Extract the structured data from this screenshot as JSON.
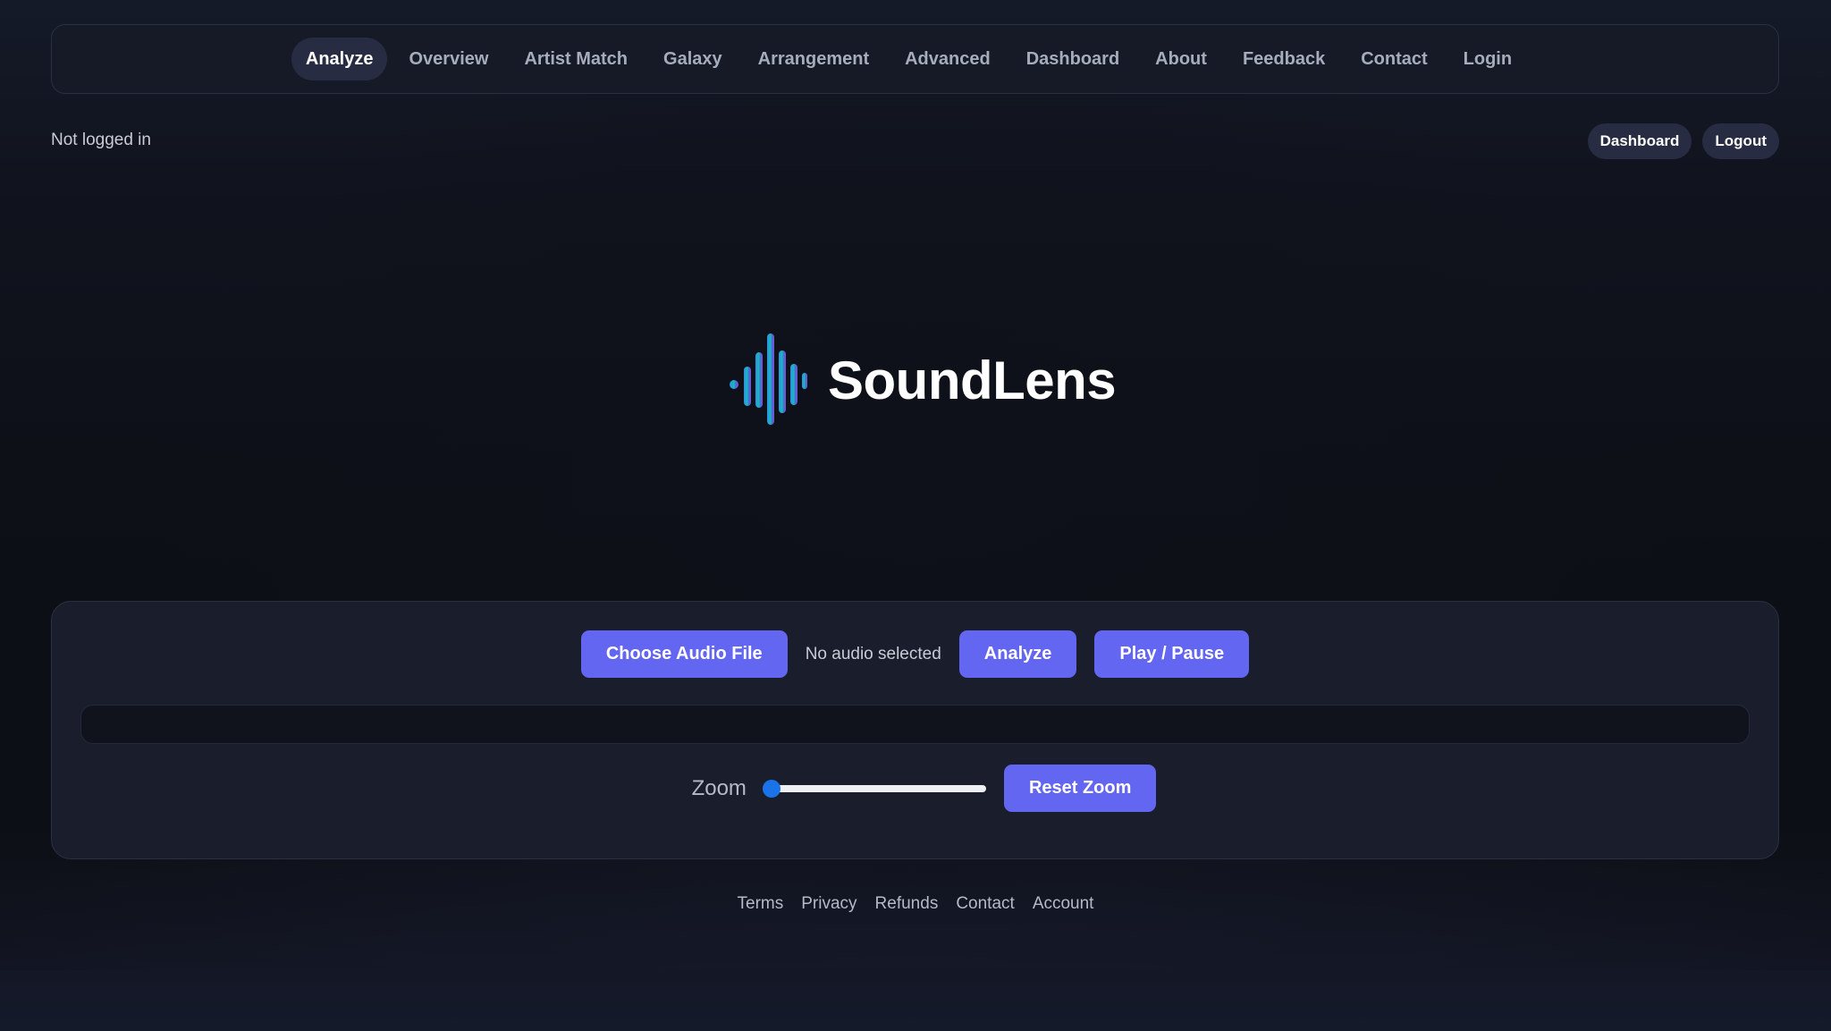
{
  "nav": {
    "items": [
      {
        "label": "Analyze",
        "active": true
      },
      {
        "label": "Overview",
        "active": false
      },
      {
        "label": "Artist Match",
        "active": false
      },
      {
        "label": "Galaxy",
        "active": false
      },
      {
        "label": "Arrangement",
        "active": false
      },
      {
        "label": "Advanced",
        "active": false
      },
      {
        "label": "Dashboard",
        "active": false
      },
      {
        "label": "About",
        "active": false
      },
      {
        "label": "Feedback",
        "active": false
      },
      {
        "label": "Contact",
        "active": false
      },
      {
        "label": "Login",
        "active": false
      }
    ]
  },
  "status": {
    "text": "Not logged in",
    "dashboard_label": "Dashboard",
    "logout_label": "Logout"
  },
  "logo": {
    "text": "SoundLens",
    "icon": "soundwave-icon"
  },
  "player": {
    "choose_label": "Choose Audio File",
    "file_status": "No audio selected",
    "analyze_label": "Analyze",
    "play_pause_label": "Play / Pause",
    "zoom_label": "Zoom",
    "zoom_value": 0,
    "reset_zoom_label": "Reset Zoom"
  },
  "footer": {
    "links": [
      "Terms",
      "Privacy",
      "Refunds",
      "Contact",
      "Account"
    ]
  },
  "colors": {
    "accent": "#6366f1",
    "slider": "#1a73e8",
    "background": "#0d0f16",
    "panel": "#1a1e2c"
  }
}
